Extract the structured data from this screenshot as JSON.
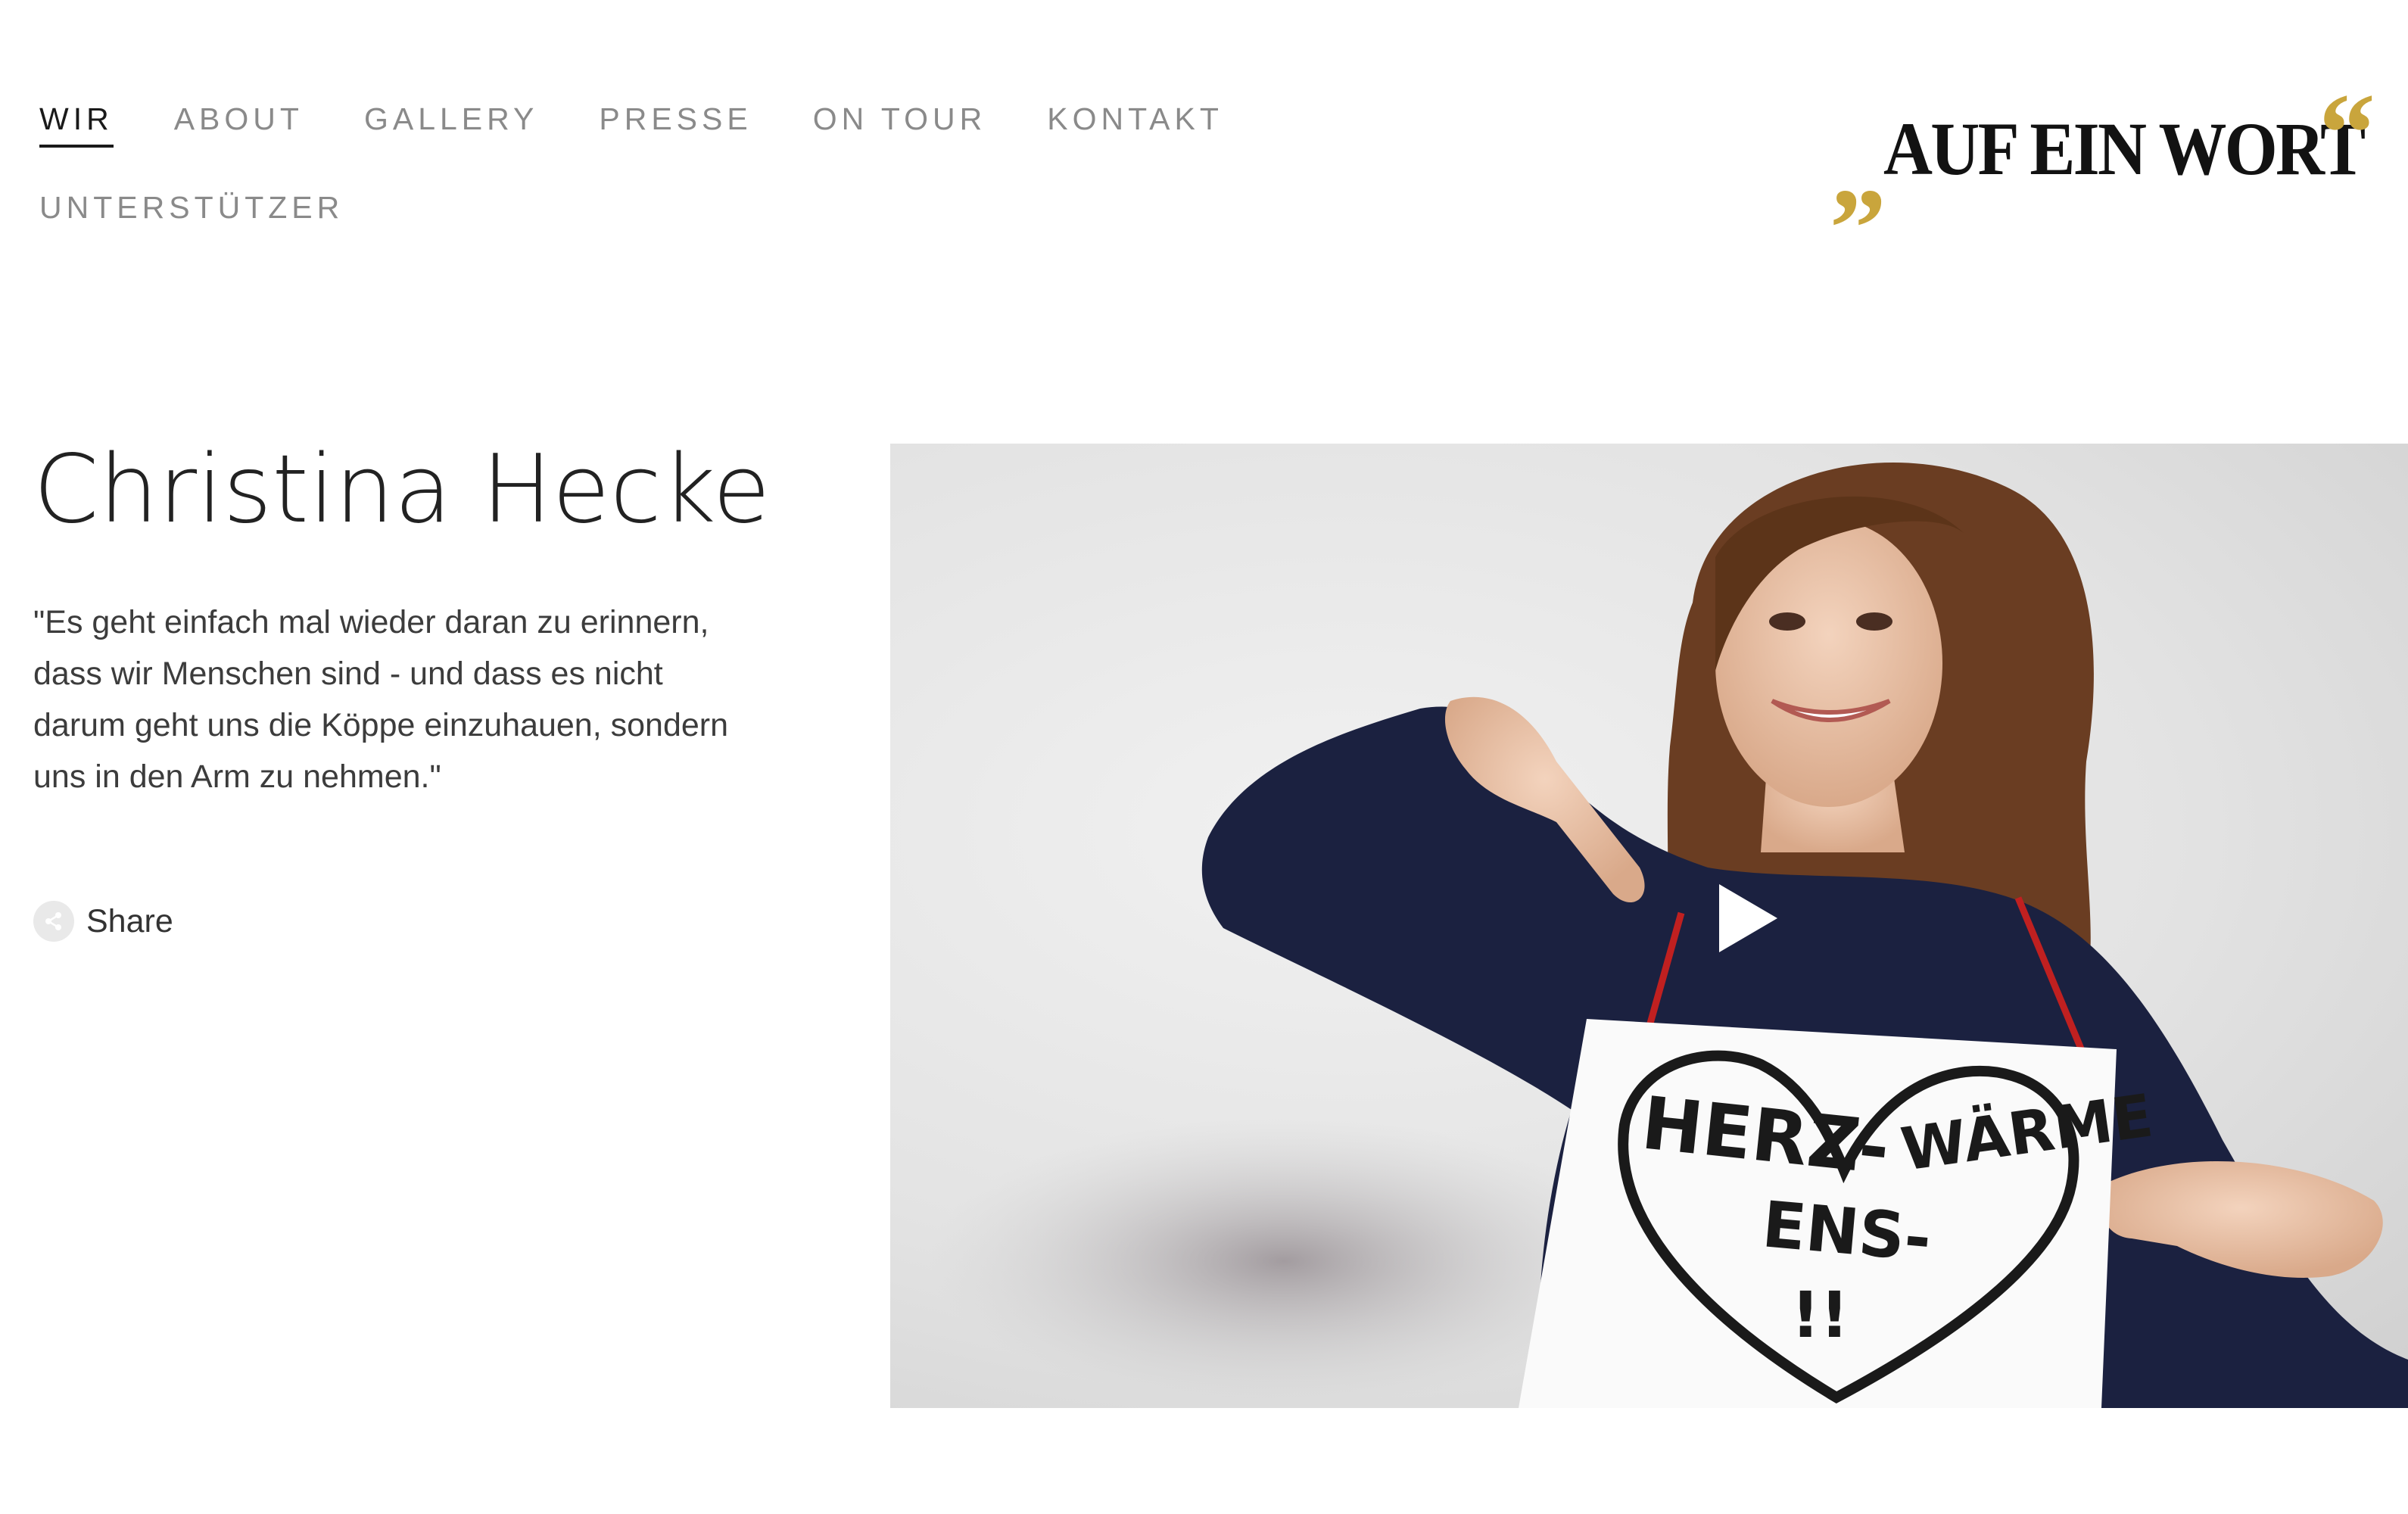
{
  "nav": {
    "items": [
      {
        "label": "WIR",
        "active": true
      },
      {
        "label": "ABOUT"
      },
      {
        "label": "GALLERY"
      },
      {
        "label": "PRESSE"
      },
      {
        "label": "ON TOUR"
      },
      {
        "label": "KONTAKT"
      },
      {
        "label": "UNTERSTÜTZER"
      }
    ]
  },
  "logo": {
    "open_quote": "„",
    "text": "AUF EIN WORT",
    "close_quote": "“"
  },
  "profile": {
    "name": "Christina Hecke",
    "quote": "\"Es geht einfach mal wieder daran zu erinnern, dass wir Menschen sind - und dass es nicht darum geht uns die Köppe einzuhauen, sondern uns in den Arm zu nehmen.\"",
    "share_label": "Share"
  },
  "video": {
    "sign_text": {
      "line1": "HERZ-",
      "line2": "ENS-",
      "line3": "WÄRME",
      "line4": "!!"
    }
  },
  "colors": {
    "accent_gold": "#c9a53c",
    "nav_active": "#1a1a1a",
    "nav_inactive": "#8a8a8a",
    "shirt": "#1b2140",
    "hair": "#6a3d22"
  }
}
